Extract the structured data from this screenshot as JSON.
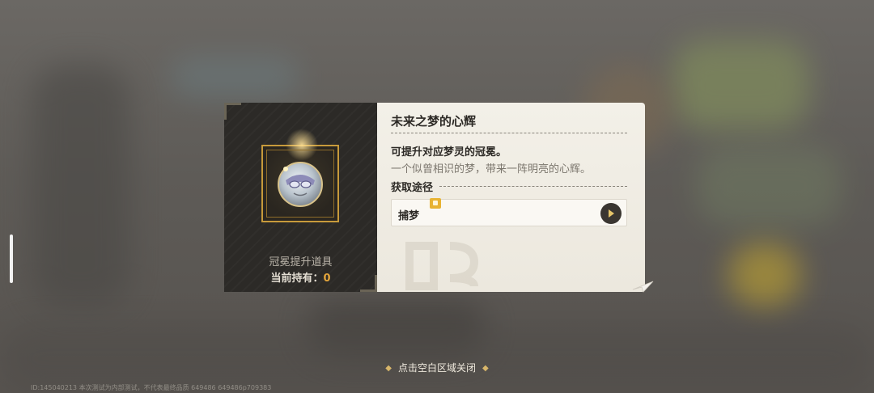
{
  "item": {
    "name": "未来之梦的心辉",
    "category": "冠冕提升道具",
    "owned_label": "当前持有：",
    "owned_count": "0",
    "icon": "masked-dream-spirit-badge-icon"
  },
  "details": {
    "description_main": "可提升对应梦灵的冠冕。",
    "description_sub": "一个似曾相识的梦，带来一阵明亮的心辉。",
    "section_label": "获取途径",
    "sources": [
      {
        "label": "捕梦",
        "tag_icon": "new-tag-icon",
        "go_icon": "arrow-right-icon"
      }
    ]
  },
  "hint": {
    "close_text": "点击空白区域关闭"
  },
  "footer": {
    "note": "ID:145040213 本次测试为内部测试，不代表最终品质 649486 649486p709383"
  },
  "colors": {
    "accent_gold": "#c79a3b",
    "count_orange": "#e3a53b",
    "panel_dark": "#2c2a27",
    "panel_light": "#f3f0e8"
  }
}
